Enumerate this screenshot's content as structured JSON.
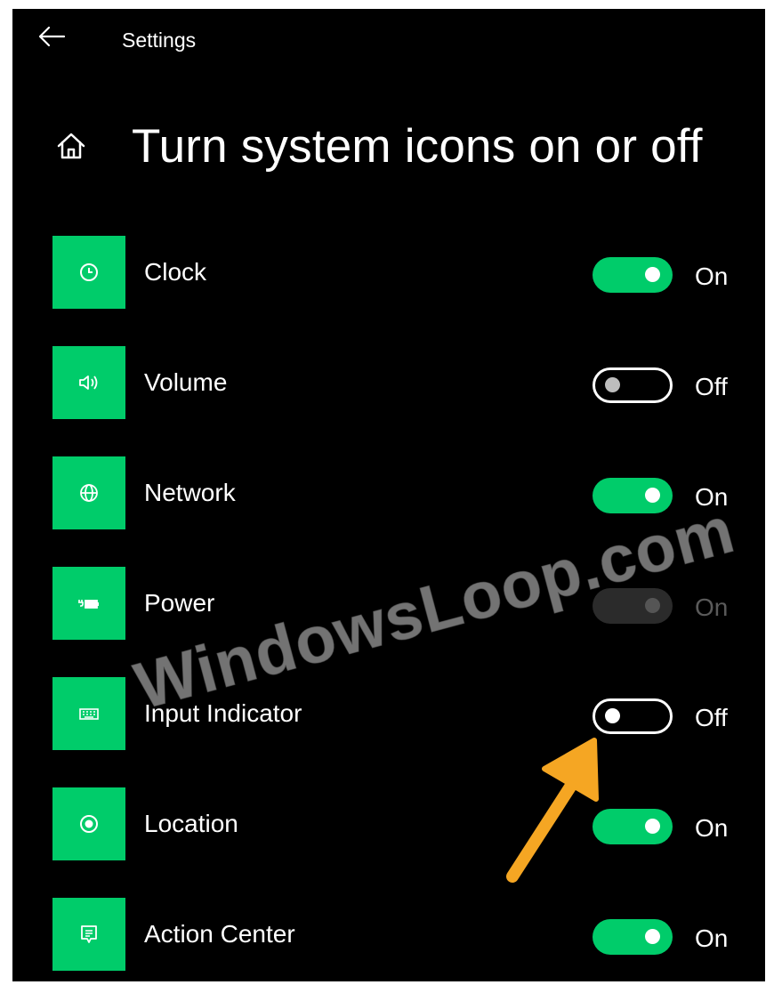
{
  "titlebar": {
    "app_title": "Settings",
    "back_icon": "back-arrow-icon"
  },
  "header": {
    "home_icon": "home-icon",
    "page_title": "Turn system icons on or off"
  },
  "items": [
    {
      "label": "Clock",
      "icon": "clock-icon",
      "state": "On",
      "on": true,
      "enabled": true
    },
    {
      "label": "Volume",
      "icon": "volume-icon",
      "state": "Off",
      "on": false,
      "enabled": true
    },
    {
      "label": "Network",
      "icon": "globe-icon",
      "state": "On",
      "on": true,
      "enabled": true
    },
    {
      "label": "Power",
      "icon": "battery-plug-icon",
      "state": "On",
      "on": true,
      "enabled": false
    },
    {
      "label": "Input Indicator",
      "icon": "keyboard-icon",
      "state": "Off",
      "on": false,
      "enabled": true
    },
    {
      "label": "Location",
      "icon": "location-icon",
      "state": "On",
      "on": true,
      "enabled": true
    },
    {
      "label": "Action Center",
      "icon": "action-center-icon",
      "state": "On",
      "on": true,
      "enabled": true
    }
  ],
  "watermark": "WindowsLoop.com",
  "colors": {
    "accent": "#00cc6a",
    "background": "#000000",
    "text": "#ffffff",
    "arrow": "#f5a623"
  }
}
